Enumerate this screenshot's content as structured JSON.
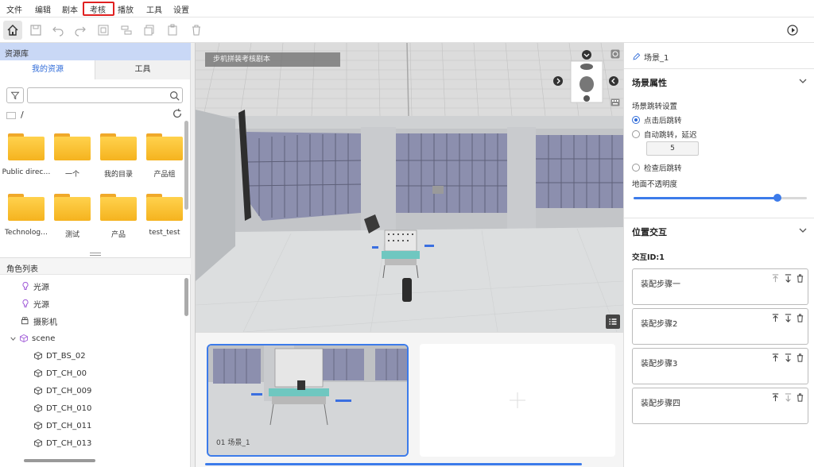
{
  "menubar": {
    "items": [
      "文件",
      "编辑",
      "剧本",
      "考核",
      "播放",
      "工具",
      "设置"
    ]
  },
  "left_panel": {
    "header": "资源库",
    "tabs": [
      "我的资源",
      "工具"
    ],
    "path": "/",
    "folders": [
      "Public direc…",
      "一个",
      "我的目录",
      "产品组",
      "Technolog…",
      "测试",
      "产品",
      "test_test"
    ],
    "roles_header": "角色列表",
    "roles": [
      "光源",
      "光源",
      "摄影机",
      "scene",
      "DT_BS_02",
      "DT_CH_00",
      "DT_CH_009",
      "DT_CH_010",
      "DT_CH_011",
      "DT_CH_013"
    ]
  },
  "viewport": {
    "scene_label": "步机拼装考核剧本"
  },
  "filmstrip": {
    "thumb_label": "01  场景_1"
  },
  "right_panel": {
    "title": "场景_1",
    "scene_props_title": "场景属性",
    "jump_settings": "场景跳转设置",
    "radio_click": "点击后跳转",
    "radio_auto": "自动跳转，延迟",
    "delay_value": "5",
    "radio_check": "检查后跳转",
    "ground_opacity": "地面不透明度",
    "ground_opacity_value": 0.83,
    "position_title": "位置交互",
    "interaction_id": "交互ID:1",
    "steps": [
      "装配步骤一",
      "装配步骤2",
      "装配步骤3",
      "装配步骤四"
    ]
  },
  "colors": {
    "accent": "#3c7bea",
    "highlight": "#e02020",
    "folder": "#f5b31f"
  }
}
